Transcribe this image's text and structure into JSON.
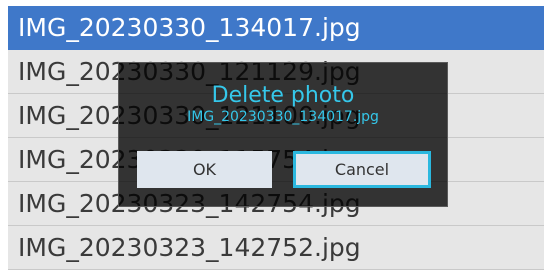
{
  "file_list": {
    "rows": [
      {
        "name": "IMG_20230330_134017.jpg",
        "selected": true
      },
      {
        "name": "IMG_20230330_121129.jpg",
        "selected": false
      },
      {
        "name": "IMG_20230330_121100.jpg",
        "selected": false
      },
      {
        "name": "IMG_20230330_115754.jpg",
        "selected": false
      },
      {
        "name": "IMG_20230323_142754.jpg",
        "selected": false
      },
      {
        "name": "IMG_20230323_142752.jpg",
        "selected": false
      }
    ]
  },
  "dialog": {
    "title": "Delete photo",
    "filename": "IMG_20230330_134017.jpg",
    "ok_label": "OK",
    "cancel_label": "Cancel"
  },
  "colors": {
    "selection": "#3f78c9",
    "dialog_accent": "#35c7ea",
    "focus_border": "#2bb8df"
  }
}
